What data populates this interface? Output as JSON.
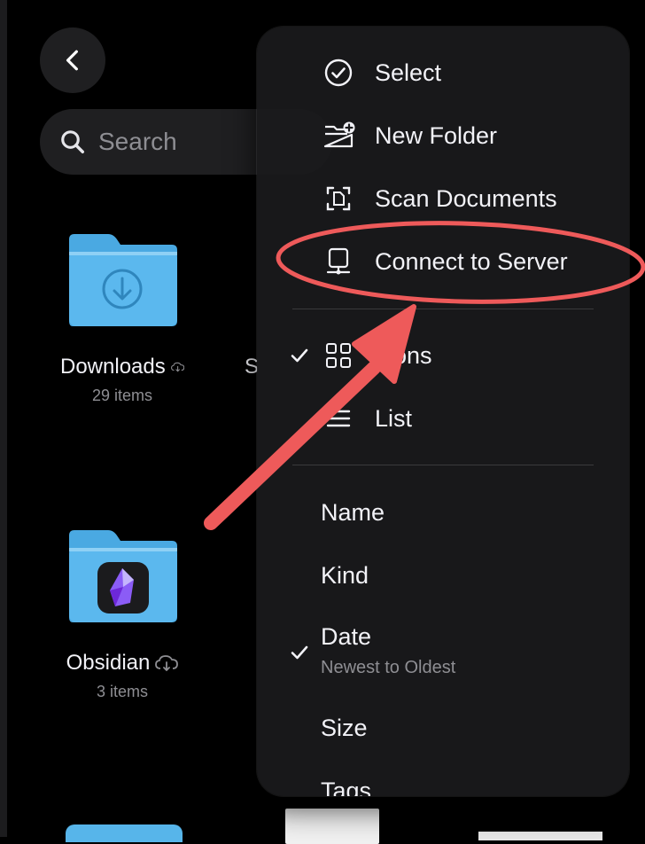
{
  "search": {
    "placeholder": "Search"
  },
  "folders": [
    {
      "name": "Downloads",
      "meta": "29 items"
    },
    {
      "name": "Obsidian",
      "meta": "3 items"
    }
  ],
  "partial_label": "S",
  "menu": {
    "actions": [
      {
        "label": "Select",
        "icon": "checkmark-circle-icon"
      },
      {
        "label": "New Folder",
        "icon": "new-folder-icon"
      },
      {
        "label": "Scan Documents",
        "icon": "scan-document-icon"
      },
      {
        "label": "Connect to Server",
        "icon": "server-icon"
      }
    ],
    "views": [
      {
        "label": "Icons",
        "icon": "grid-icon",
        "checked": true
      },
      {
        "label": "List",
        "icon": "list-icon",
        "checked": false
      }
    ],
    "sort": [
      {
        "label": "Name",
        "checked": false
      },
      {
        "label": "Kind",
        "checked": false
      },
      {
        "label": "Date",
        "checked": true,
        "sub": "Newest to Oldest"
      },
      {
        "label": "Size",
        "checked": false
      },
      {
        "label": "Tags",
        "checked": false
      }
    ]
  },
  "colors": {
    "folder_blue": "#5bb8ee",
    "annotation_red": "#ee5a5a"
  }
}
